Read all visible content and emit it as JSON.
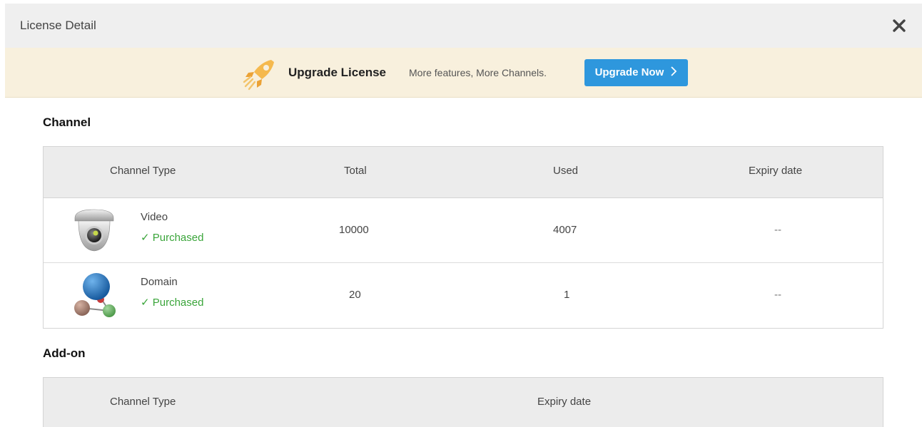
{
  "dialog": {
    "title": "License Detail",
    "close_icon": "close-icon"
  },
  "banner": {
    "icon": "rocket-icon",
    "title": "Upgrade License",
    "description": "More features, More Channels.",
    "button_label": "Upgrade Now",
    "button_icon": "chevron-right-icon",
    "button_color": "#2e97dd",
    "background": "#f8f0dd"
  },
  "channel": {
    "heading": "Channel",
    "columns": [
      "Channel Type",
      "Total",
      "Used",
      "Expiry date"
    ],
    "rows": [
      {
        "icon": "camera-icon",
        "type": "Video",
        "status": "✓ Purchased",
        "total": "10000",
        "used": "4007",
        "expiry": "--"
      },
      {
        "icon": "domain-icon",
        "type": "Domain",
        "status": "✓ Purchased",
        "total": "20",
        "used": "1",
        "expiry": "--"
      }
    ]
  },
  "addon": {
    "heading": "Add-on",
    "columns": [
      "Channel Type",
      "Expiry date"
    ]
  },
  "colors": {
    "purchased": "#3aa53a",
    "header_bg": "#efefef",
    "table_header_bg": "#ececec"
  }
}
